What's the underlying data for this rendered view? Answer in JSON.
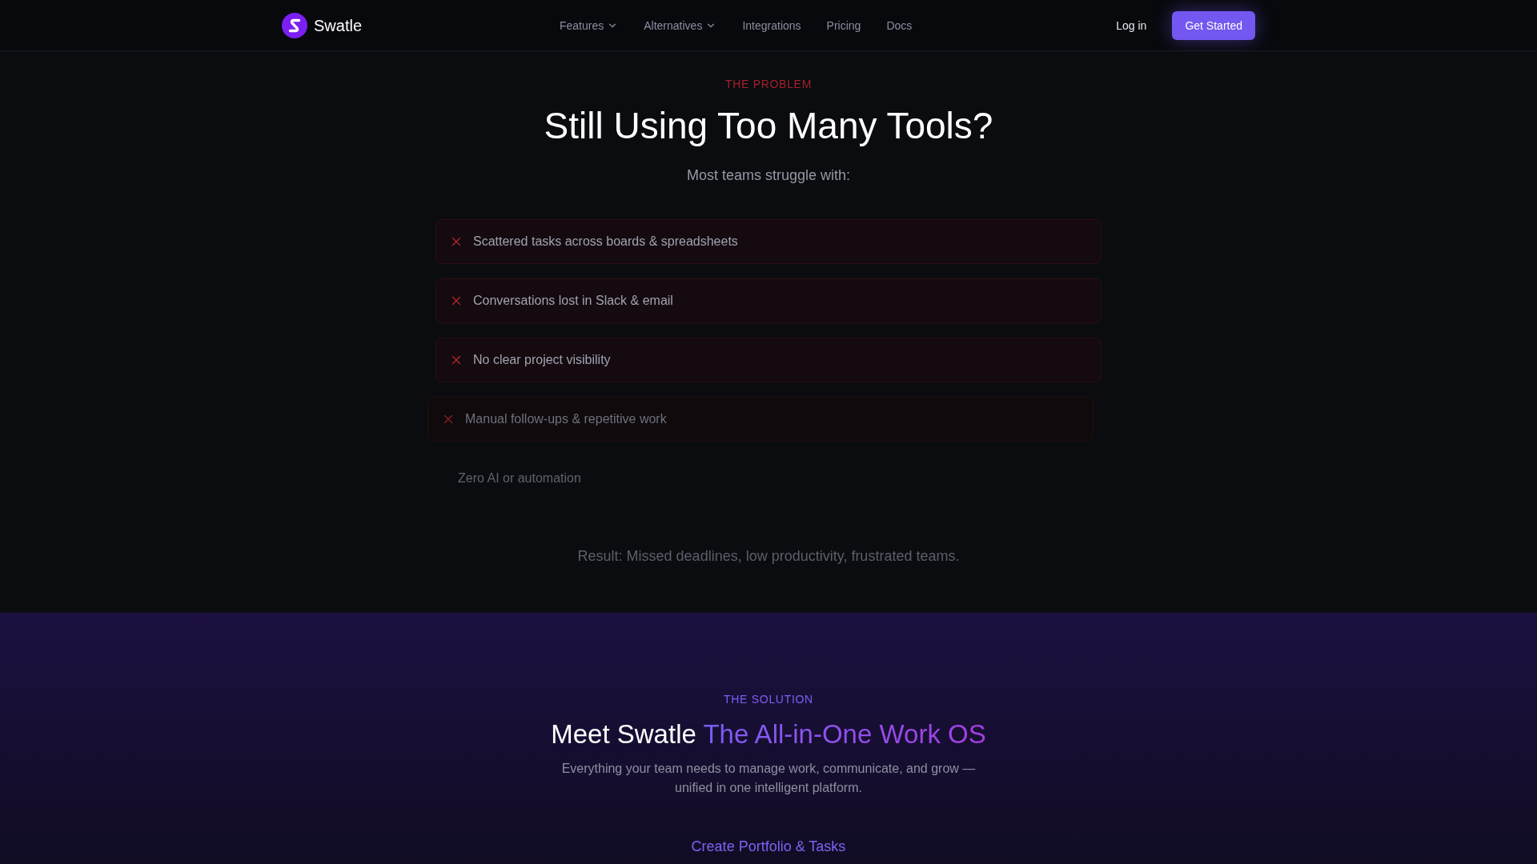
{
  "nav": {
    "brand": "Swatle",
    "links": [
      {
        "label": "Features",
        "has_menu": true
      },
      {
        "label": "Alternatives",
        "has_menu": true
      },
      {
        "label": "Integrations",
        "has_menu": false
      },
      {
        "label": "Pricing",
        "has_menu": false
      },
      {
        "label": "Docs",
        "has_menu": false
      }
    ],
    "login": "Log in",
    "cta": "Get Started"
  },
  "problem": {
    "eyebrow": "THE PROBLEM",
    "title": "Still Using Too Many Tools?",
    "subtitle": "Most teams struggle with:",
    "items": [
      {
        "text": "Scattered tasks across boards & spreadsheets",
        "dimmed": false,
        "faint": false
      },
      {
        "text": "Conversations lost in Slack & email",
        "dimmed": false,
        "faint": false
      },
      {
        "text": "No clear project visibility",
        "dimmed": false,
        "faint": false
      },
      {
        "text": "Manual follow-ups & repetitive work",
        "dimmed": true,
        "faint": false
      },
      {
        "text": "Zero AI or automation",
        "dimmed": true,
        "faint": true
      }
    ],
    "result": {
      "text": "Result: Missed deadlines, low productivity, frustrated teams.",
      "faint": true
    }
  },
  "solution": {
    "eyebrow": "THE SOLUTION",
    "title_lead": "Meet Swatle",
    "title_highlight": "The All-in-One Work OS",
    "description": "Everything your team needs to manage work, communicate, and grow — unified in one intelligent platform.",
    "feature_title": "Create Portfolio & Tasks"
  }
}
